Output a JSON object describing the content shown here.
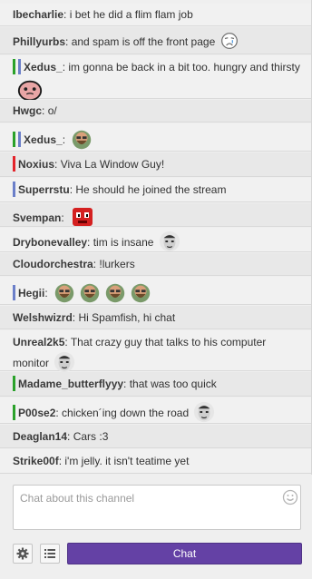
{
  "chat": {
    "messages": [
      {
        "user": "Ibecharlie",
        "text": "i bet he did a flim flam job"
      },
      {
        "user": "Phillyurbs",
        "text": "and spam is off the front page",
        "emote": "sad-face-icon"
      },
      {
        "user": "Xedus_",
        "text": "im gonna be back in a bit too. hungry and thirsty",
        "emote": "crying-blob-emote-icon",
        "badges": [
          "green",
          "blue"
        ]
      },
      {
        "user": "Hwgc",
        "text": "o/"
      },
      {
        "user": "Xedus_",
        "text": "",
        "emote": "bearded-guy-emote-icon",
        "badges": [
          "green",
          "blue"
        ]
      },
      {
        "user": "Noxius",
        "text": "Viva La Window Guy!",
        "badges": [
          "red"
        ]
      },
      {
        "user": "Superrstu",
        "text": "He should he joined the stream",
        "badges": [
          "blue"
        ]
      },
      {
        "user": "Svempan",
        "text": "",
        "emote": "red-meat-boy-emote-icon"
      },
      {
        "user": "Drybonevalley",
        "text": "tim is insane",
        "emote": "face-emote-icon"
      },
      {
        "user": "Cloudorchestra",
        "text": "!lurkers"
      },
      {
        "user": "Hegii",
        "text": "",
        "emote": "bearded-guy-emote-icon",
        "emote_count": 4,
        "badges": [
          "blue"
        ]
      },
      {
        "user": "Welshwizrd",
        "text": "Hi Spamfish, hi chat"
      },
      {
        "user": "Unreal2k5",
        "text": "That crazy guy that talks to his computer monitor",
        "emote": "face-emote-icon"
      },
      {
        "user": "Madame_butterflyyy",
        "text": "that was too quick",
        "badges": [
          "green"
        ]
      },
      {
        "user": "P00se2",
        "text": "chicken´ing down the road",
        "emote": "face-emote-icon",
        "badges": [
          "green"
        ]
      },
      {
        "user": "Deaglan14",
        "text": "Cars :3"
      },
      {
        "user": "Strike00f",
        "text": "i'm jelly. it isn't teatime yet"
      }
    ]
  },
  "input": {
    "placeholder": "Chat about this channel",
    "chat_button": "Chat"
  },
  "colors": {
    "accent": "#6441a5",
    "badge_green": "#2aa12a",
    "badge_blue": "#6b7fc9",
    "badge_red": "#e3242b"
  }
}
